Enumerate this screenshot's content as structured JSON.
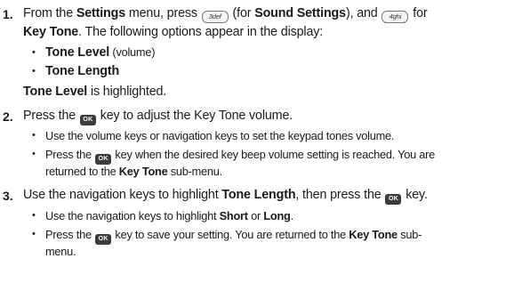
{
  "steps": [
    {
      "number": "1.",
      "line1": {
        "a": "From the ",
        "b": "Settings",
        "c": " menu, press ",
        "key3": "3def",
        "d": " (for ",
        "e": "Sound Settings",
        "f": "), and ",
        "key4": "4ghi",
        "g": " for"
      },
      "line2": {
        "a": "Key Tone",
        "b": ". The following options appear in the display:"
      },
      "bullets": [
        {
          "bold": "Tone Level",
          "rest": " (volume)"
        },
        {
          "bold": "Tone Length",
          "rest": ""
        }
      ],
      "after": {
        "bold": "Tone Level",
        "rest": " is highlighted."
      }
    },
    {
      "number": "2.",
      "line1": {
        "a": "Press the ",
        "key": "OK",
        "b": " key to adjust the Key Tone volume."
      },
      "sub": [
        {
          "text": "Use the volume keys or navigation keys to set the keypad tones volume."
        },
        {
          "a": "Press the ",
          "key": "OK",
          "b": " key when the desired key beep volume setting is reached. You are",
          "c": "returned to the ",
          "d": "Key Tone",
          "e": " sub-menu."
        }
      ]
    },
    {
      "number": "3.",
      "line1": {
        "a": "Use the navigation keys to highlight ",
        "b": "Tone Length",
        "c": ", then press the ",
        "key": "OK",
        "d": " key."
      },
      "sub": [
        {
          "a": "Use the navigation keys to highlight ",
          "b": "Short",
          "c": " or ",
          "d": "Long",
          "e": "."
        },
        {
          "a": "Press the ",
          "key": "OK",
          "b": " key to save your setting. You are returned to the ",
          "c": "Key Tone",
          "d": " sub-",
          "e": "menu."
        }
      ]
    }
  ],
  "bullet_glyph": "•"
}
